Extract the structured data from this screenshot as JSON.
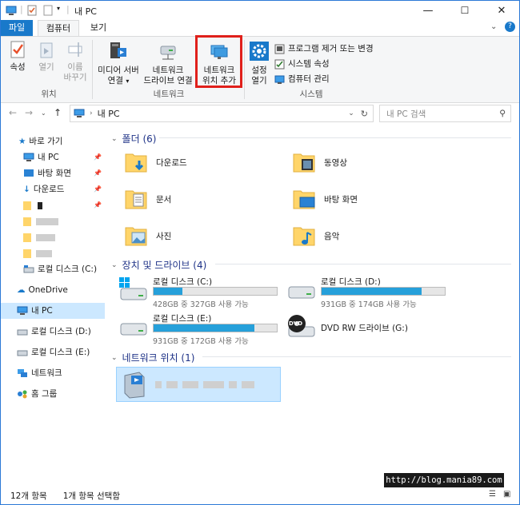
{
  "window": {
    "title": "내 PC",
    "controls": {
      "minimize": "—",
      "maximize": "☐",
      "close": "✕"
    }
  },
  "ribbon": {
    "tabs": {
      "file": "파일",
      "computer": "컴퓨터",
      "view": "보기"
    },
    "location_group": {
      "label": "위치",
      "properties": "속성",
      "open": "열기",
      "rename_line1": "이름",
      "rename_line2": "바꾸기"
    },
    "network_group": {
      "label": "네트워크",
      "media_line1": "미디어 서버",
      "media_line2": "연결",
      "map_line1": "네트워크",
      "map_line2": "드라이브 연결",
      "add_line1": "네트워크",
      "add_line2": "위치 추가"
    },
    "system_group": {
      "label": "시스템",
      "settings_line1": "설정",
      "settings_line2": "열기",
      "uninstall": "프로그램 제거 또는 변경",
      "sys_props": "시스템 속성",
      "manage": "컴퓨터 관리"
    }
  },
  "address_bar": {
    "path_current": "내 PC",
    "search_placeholder": "내 PC 검색"
  },
  "nav_pane": {
    "quick_access": "바로 가기",
    "this_pc_quick": "내 PC",
    "desktop": "바탕 화면",
    "downloads": "다운로드",
    "local_c": "로컬 디스크 (C:)",
    "onedrive": "OneDrive",
    "this_pc": "내 PC",
    "local_d": "로컬 디스크 (D:)",
    "local_e": "로컬 디스크 (E:)",
    "network": "네트워크",
    "homegroup": "홈 그룹"
  },
  "content": {
    "folders_header": "폴더 (6)",
    "folders": {
      "downloads": "다운로드",
      "videos": "동영상",
      "documents": "문서",
      "desktop": "바탕 화면",
      "pictures": "사진",
      "music": "음악"
    },
    "devices_header": "장치 및 드라이브 (4)",
    "drives": {
      "c": {
        "name": "로컬 디스크 (C:)",
        "free": "428GB 중 327GB 사용 가능",
        "used_fraction": 0.236
      },
      "d": {
        "name": "로컬 디스크 (D:)",
        "free": "931GB 중 174GB 사용 가능",
        "used_fraction": 0.813
      },
      "e": {
        "name": "로컬 디스크 (E:)",
        "free": "931GB 중 172GB 사용 가능",
        "used_fraction": 0.815
      },
      "g": {
        "name": "DVD RW 드라이브 (G:)",
        "dvd_label": "DVD"
      }
    },
    "network_header": "네트워크 위치 (1)"
  },
  "status_bar": {
    "item_count": "12개 항목",
    "selected": "1개 항목 선택함"
  },
  "watermark": "http://blog.mania89.com",
  "colors": {
    "accent": "#1979ca",
    "highlight_red": "#e0201b",
    "bar_fill": "#26a0da",
    "folder_yellow": "#ffd56a"
  }
}
